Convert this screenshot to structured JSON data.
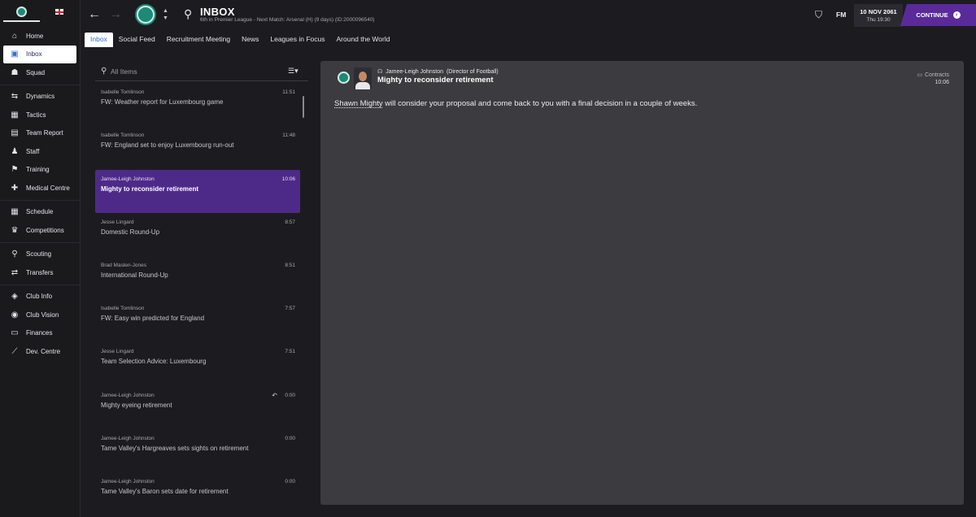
{
  "sidebar": {
    "items": [
      {
        "label": "Home",
        "icon": "home-icon"
      },
      {
        "label": "Inbox",
        "icon": "inbox-icon"
      },
      {
        "label": "Squad",
        "icon": "squad-icon"
      },
      {
        "label": "Dynamics",
        "icon": "dynamics-icon"
      },
      {
        "label": "Tactics",
        "icon": "tactics-icon"
      },
      {
        "label": "Team Report",
        "icon": "report-icon"
      },
      {
        "label": "Staff",
        "icon": "staff-icon"
      },
      {
        "label": "Training",
        "icon": "training-icon"
      },
      {
        "label": "Medical Centre",
        "icon": "medical-icon"
      },
      {
        "label": "Schedule",
        "icon": "schedule-icon"
      },
      {
        "label": "Competitions",
        "icon": "trophy-icon"
      },
      {
        "label": "Scouting",
        "icon": "scouting-icon"
      },
      {
        "label": "Transfers",
        "icon": "transfers-icon"
      },
      {
        "label": "Club Info",
        "icon": "club-info-icon"
      },
      {
        "label": "Club Vision",
        "icon": "club-vision-icon"
      },
      {
        "label": "Finances",
        "icon": "finances-icon"
      },
      {
        "label": "Dev. Centre",
        "icon": "dev-centre-icon"
      }
    ]
  },
  "header": {
    "title": "INBOX",
    "subtitle": "6th in Premier League - Next Match: Arsenal (H) (9 days) (ID:2000096540)",
    "fm_label": "FM",
    "date": "10 NOV 2061",
    "day_time": "Thu 19:30",
    "continue_label": "CONTINUE"
  },
  "tabs": [
    "Inbox",
    "Social Feed",
    "Recruitment Meeting",
    "News",
    "Leagues in Focus",
    "Around the World"
  ],
  "list": {
    "filter_label": "All Items",
    "messages": [
      {
        "sender": "Isabelle Tomlinson",
        "time": "11:51",
        "subject": "FW: Weather report for Luxembourg game"
      },
      {
        "sender": "Isabelle Tomlinson",
        "time": "11:48",
        "subject": "FW: England set to enjoy Luxembourg run-out"
      },
      {
        "sender": "Jamee-Leigh Johnston",
        "time": "10:06",
        "subject": "Mighty to reconsider retirement"
      },
      {
        "sender": "Jesse Lingard",
        "time": "8:57",
        "subject": "Domestic Round-Up"
      },
      {
        "sender": "Brad Maslen-Jones",
        "time": "8:51",
        "subject": "International Round-Up"
      },
      {
        "sender": "Isabelle Tomlinson",
        "time": "7:57",
        "subject": "FW: Easy win predicted for England"
      },
      {
        "sender": "Jesse Lingard",
        "time": "7:51",
        "subject": "Team Selection Advice: Luxembourg"
      },
      {
        "sender": "Jamee-Leigh Johnston",
        "time": "0:00",
        "subject": "Mighty eyeing retirement"
      },
      {
        "sender": "Jamee-Leigh Johnston",
        "time": "0:00",
        "subject": "Tame Valley's Hargreaves sets sights on retirement"
      },
      {
        "sender": "Jamee-Leigh Johnston",
        "time": "0:00",
        "subject": "Tame Valley's Baron sets date for retirement"
      }
    ]
  },
  "detail": {
    "sender": "Jamee-Leigh Johnston",
    "sender_role": "(Director of Football)",
    "subject": "Mighty to reconsider retirement",
    "tag": "Contracts",
    "time": "10:06",
    "body_link": "Shawn Mighty",
    "body_text": " will consider your proposal and come back to you with a final decision in a couple of weeks."
  }
}
